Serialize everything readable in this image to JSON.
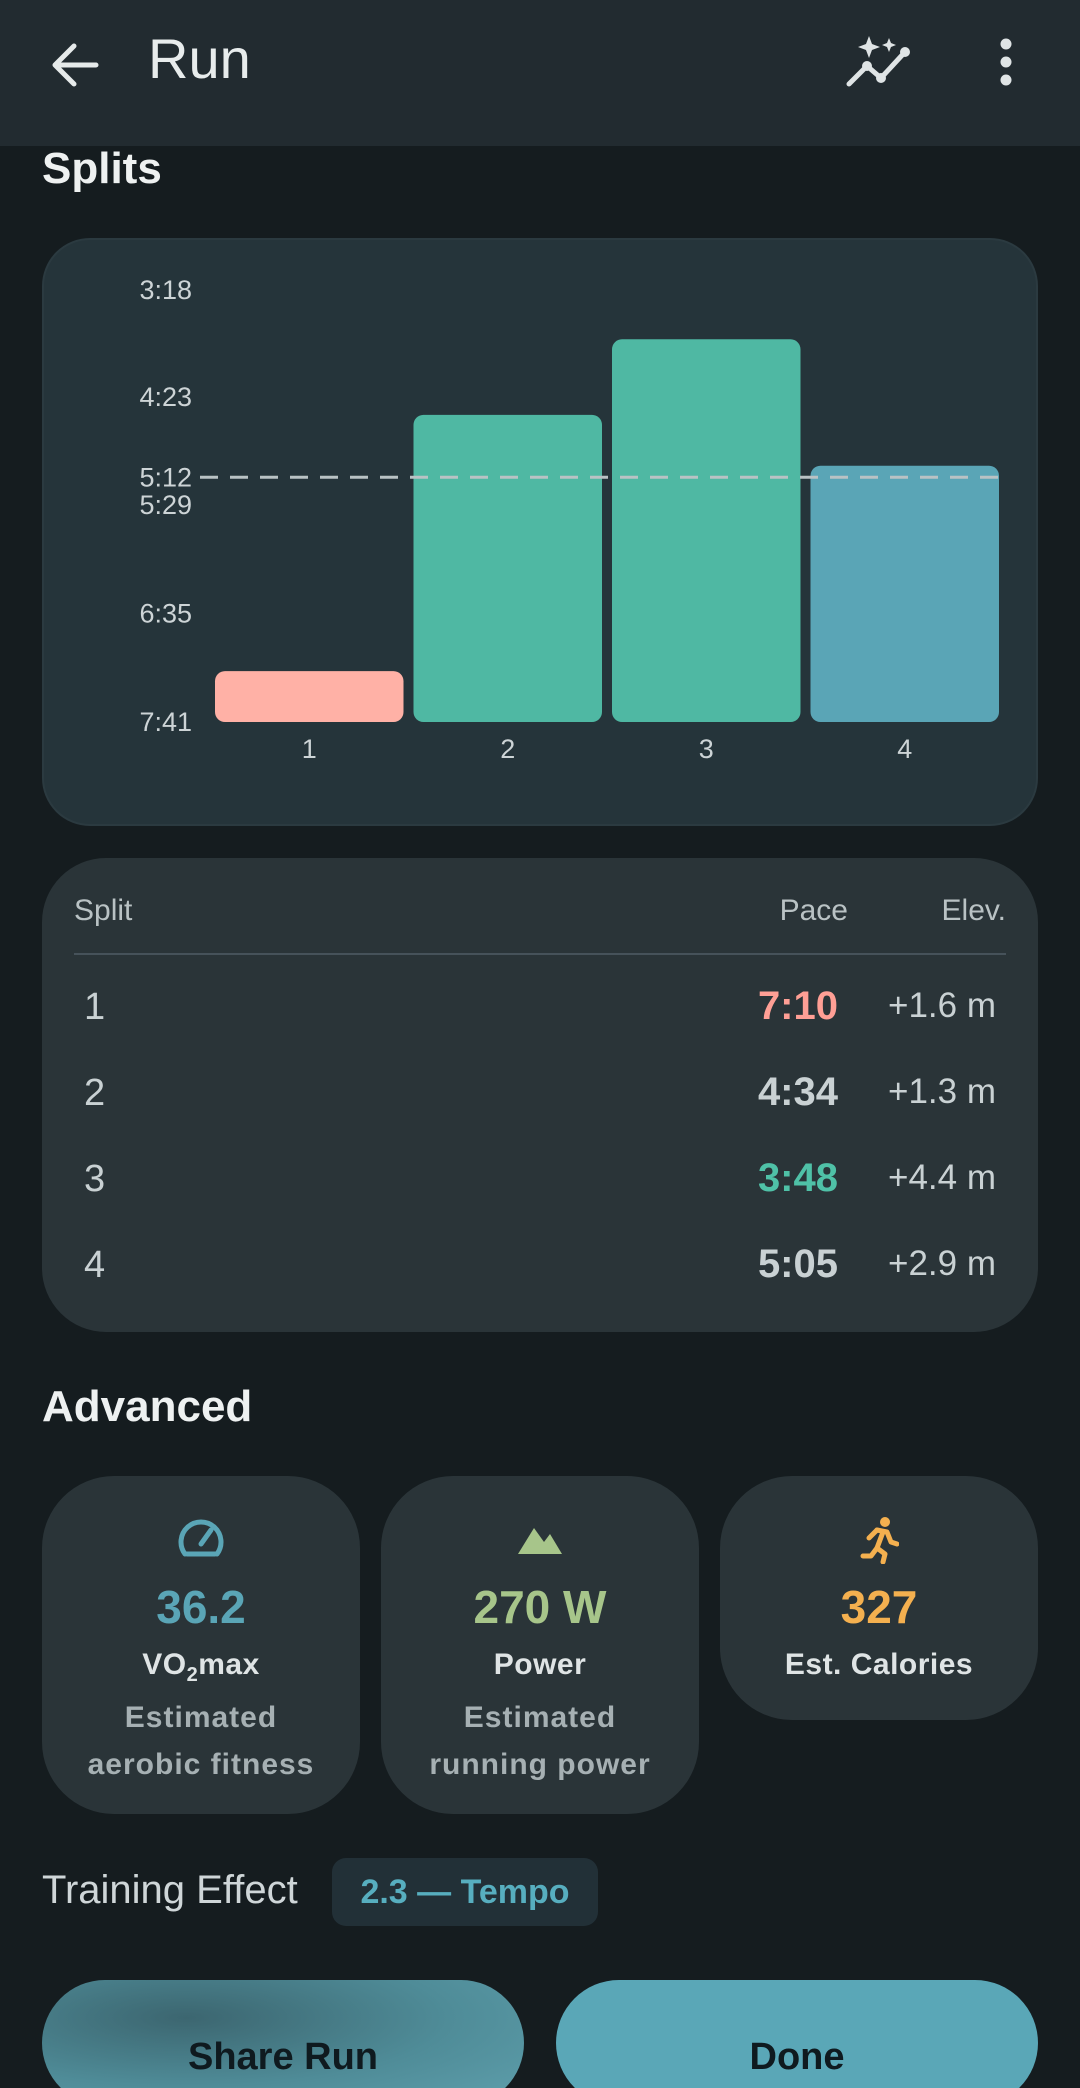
{
  "appbar": {
    "back_icon": "arrow-back-icon",
    "title": "Run",
    "trend_icon": "sparkle-trend-icon",
    "more_icon": "more-vertical-icon"
  },
  "splits_title": "Splits",
  "chart_data": {
    "type": "bar",
    "categories": [
      "1",
      "2",
      "3",
      "4"
    ],
    "values": [
      "7:10",
      "4:34",
      "3:48",
      "5:05"
    ],
    "values_seconds": [
      430,
      274,
      228,
      305
    ],
    "y_ticks": [
      "3:18",
      "4:23",
      "5:12",
      "5:29",
      "6:35",
      "7:41"
    ],
    "y_ticks_seconds": [
      198,
      263,
      312,
      329,
      395,
      461
    ],
    "y_range_seconds": [
      198,
      461
    ],
    "y_axis_inverted": true,
    "reference_line": {
      "label": "5:12",
      "value_seconds": 312,
      "style": "dashed"
    },
    "bar_colors": [
      "#ffb1a6",
      "#4fb8a3",
      "#4fb8a3",
      "#5aa5b6"
    ],
    "grid": false,
    "legend": "none"
  },
  "table": {
    "headers": {
      "split": "Split",
      "pace": "Pace",
      "elev": "Elev."
    },
    "rows": [
      {
        "split": "1",
        "pace": "7:10",
        "elev": "+1.6 m",
        "pace_color": "#ff9f95"
      },
      {
        "split": "2",
        "pace": "4:34",
        "elev": "+1.3 m",
        "pace_color": "#c9d1d3"
      },
      {
        "split": "3",
        "pace": "3:48",
        "elev": "+4.4 m",
        "pace_color": "#4fc1a7"
      },
      {
        "split": "4",
        "pace": "5:05",
        "elev": "+2.9 m",
        "pace_color": "#c9d1d3"
      }
    ]
  },
  "advanced_title": "Advanced",
  "advanced": [
    {
      "icon": "speedometer-icon",
      "value": "36.2",
      "label_main": "VO",
      "label_sub": "2",
      "label_tail": "max",
      "desc1": "Estimated",
      "desc2": "aerobic fitness",
      "color": "#5aa5b6"
    },
    {
      "icon": "mountain-icon",
      "value": "270 W",
      "label": "Power",
      "desc1": "Estimated",
      "desc2": "running power",
      "color": "#a7c58a"
    },
    {
      "icon": "running-person-icon",
      "value": "327",
      "label": "Est. Calories",
      "color": "#f4b04f"
    }
  ],
  "training_effect": {
    "label": "Training Effect",
    "value": "2.3 — Tempo"
  },
  "buttons": {
    "share": "Share Run",
    "done": "Done"
  }
}
